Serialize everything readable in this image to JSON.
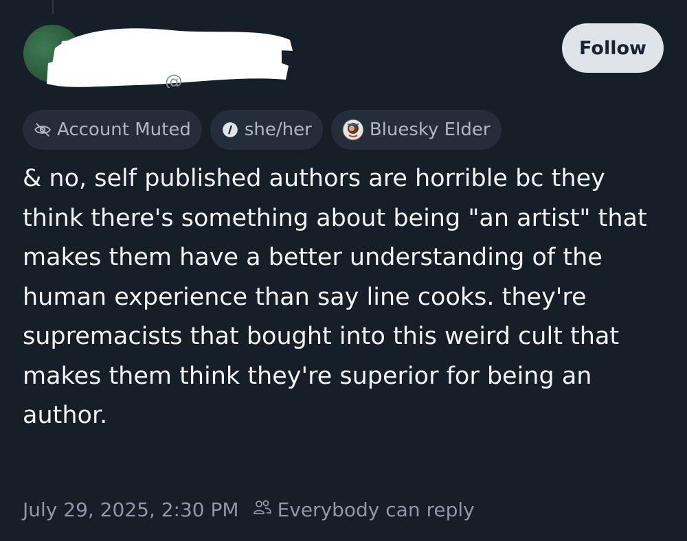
{
  "post": {
    "follow_label": "Follow",
    "handle_fragment": "@",
    "labels": [
      {
        "icon": "eye-slash-icon",
        "text": "Account Muted"
      },
      {
        "icon": "info-circle-icon",
        "text": "she/her"
      },
      {
        "icon": "badge-avatar-icon",
        "text": "Bluesky Elder"
      }
    ],
    "body": "& no, self published authors are horrible bc they think there's something about being \"an artist\" that makes them have a better understanding of the human experience than say line cooks. they're supremacists that bought into this weird cult that makes them think they're superior for being an author.",
    "timestamp": "July 29, 2025, 2:30 PM",
    "reply_setting": "Everybody can reply",
    "reply_icon": "people-icon"
  },
  "colors": {
    "background": "#161e27",
    "pill_background": "#232e3a",
    "follow_button": "#dfe4ea",
    "body_text": "#f1f3f5",
    "muted_text": "#8d98a8"
  }
}
